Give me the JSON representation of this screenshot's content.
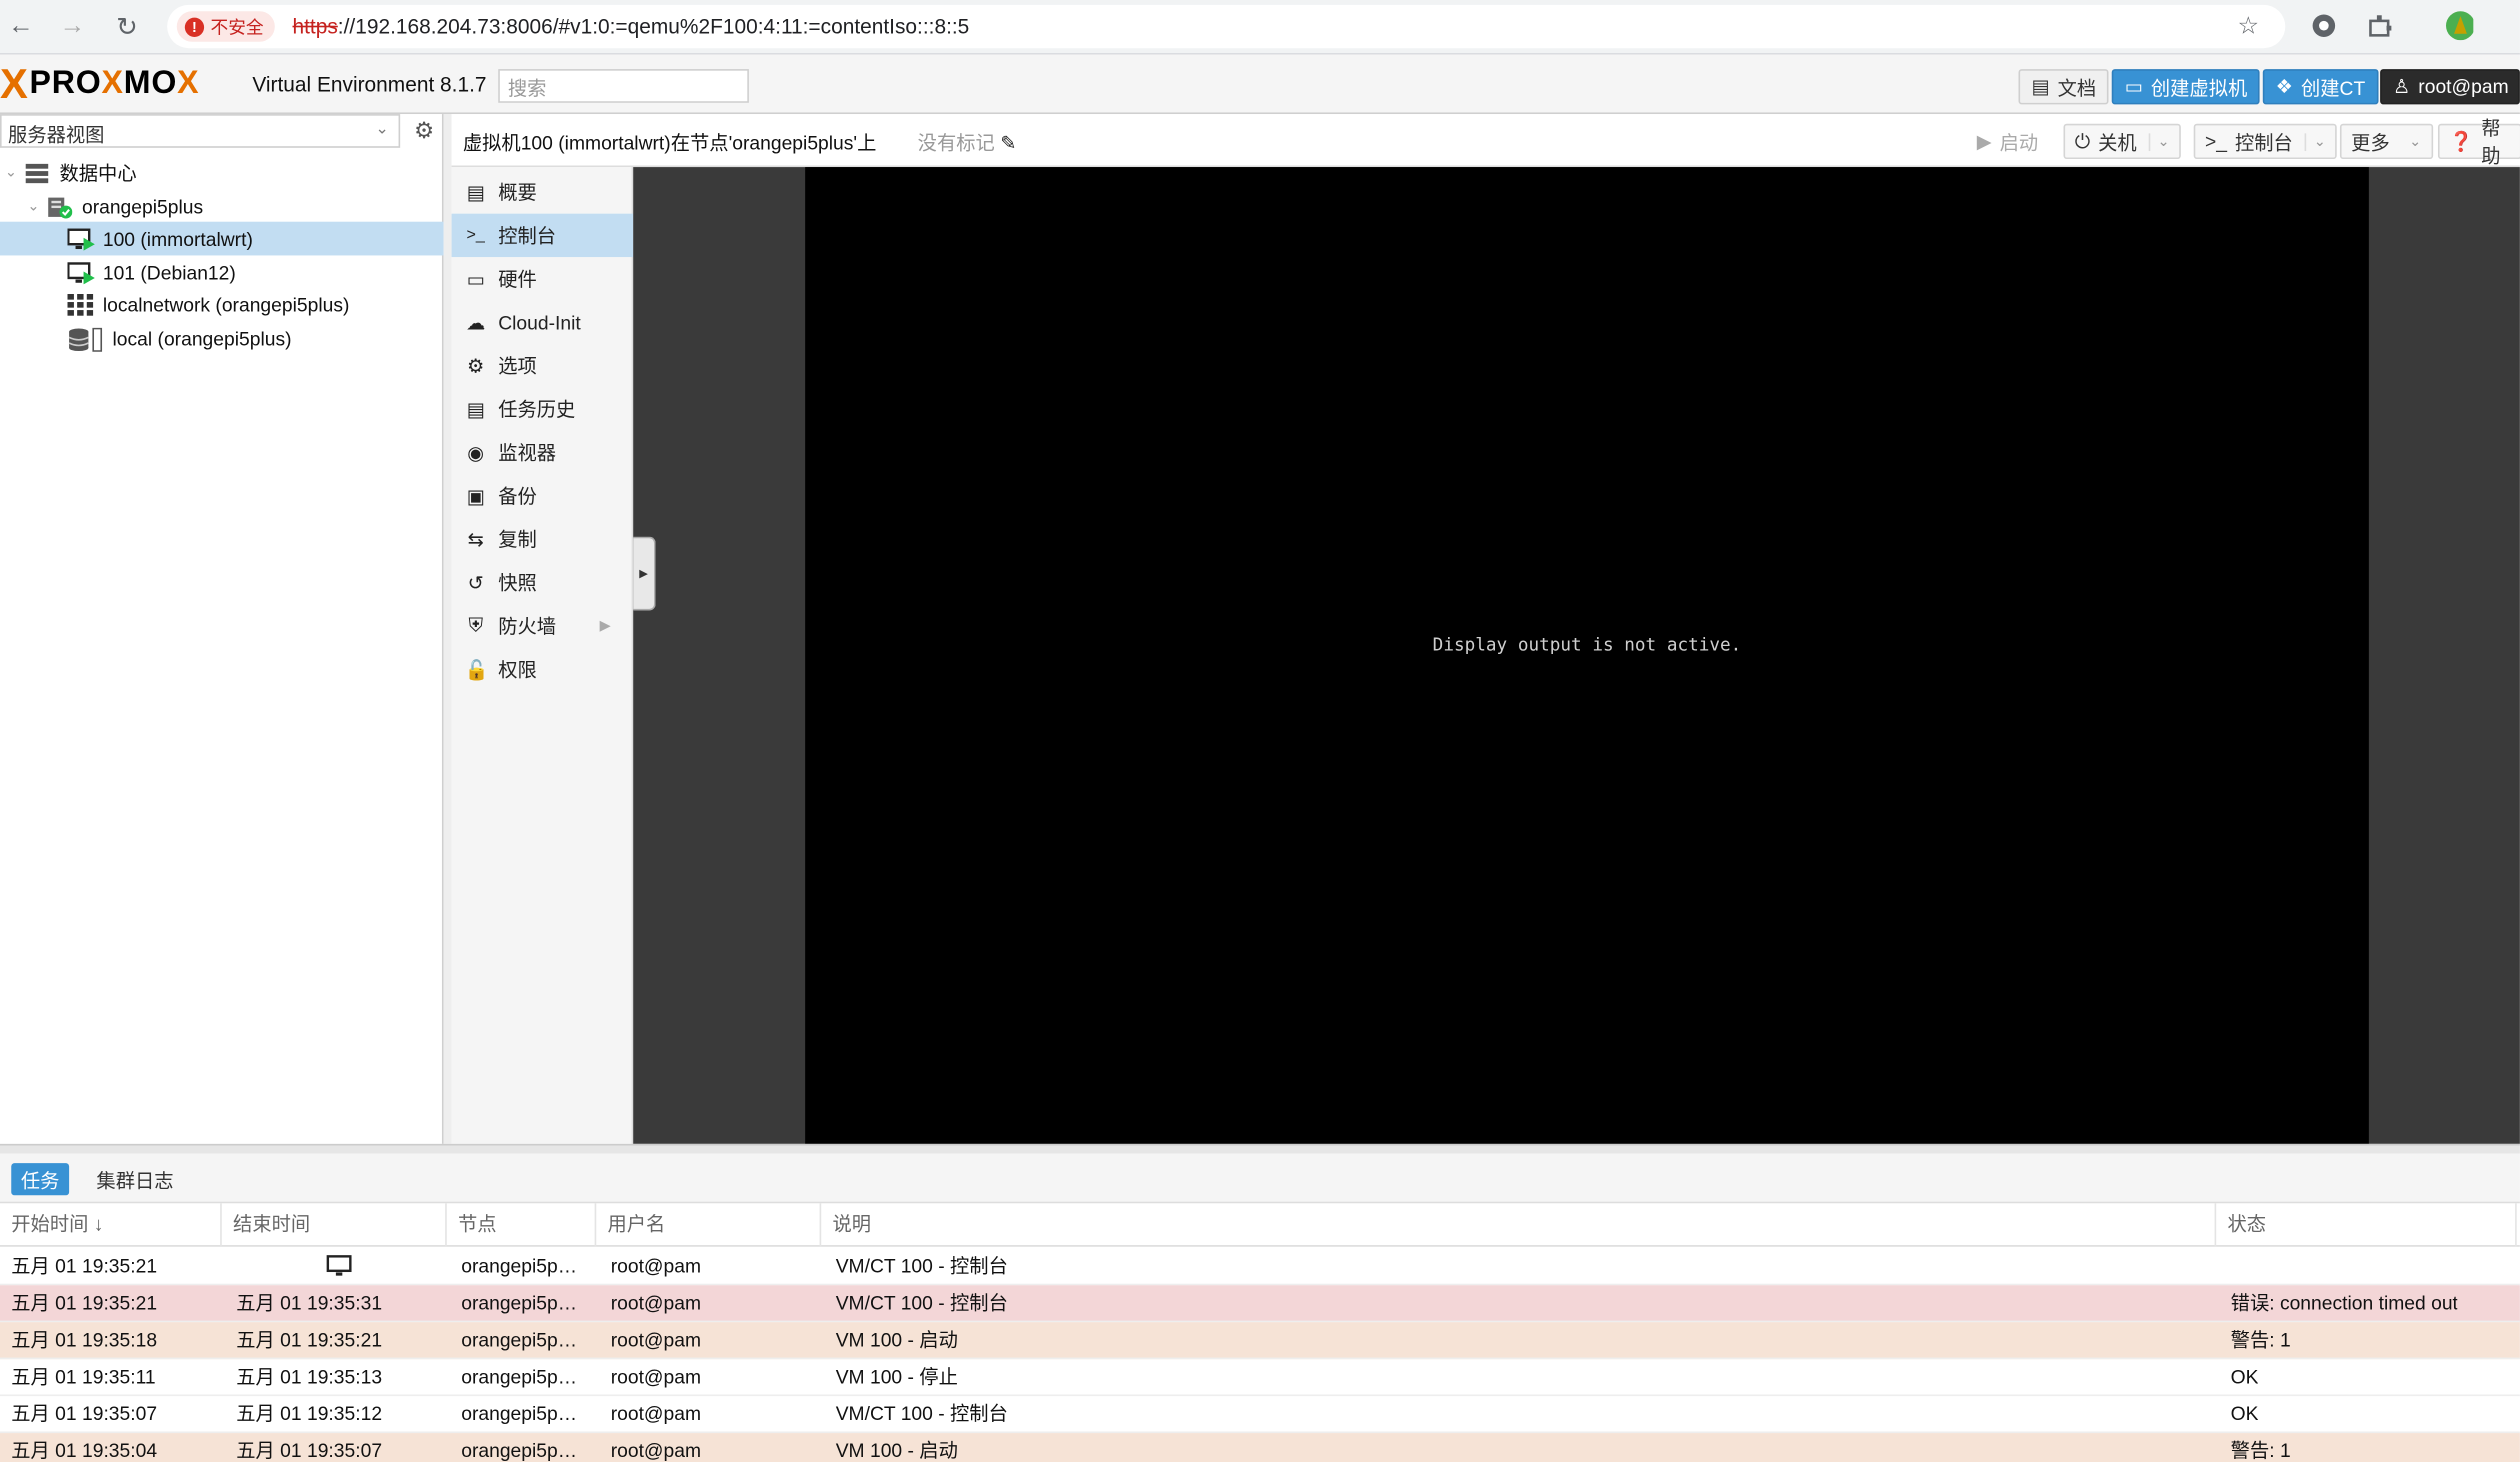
{
  "browser": {
    "insecure_label": "不安全",
    "url_scheme": "https",
    "url_rest": "://192.168.204.73:8006/#v1:0:=qemu%2F100:4:11:=contentIso:::8::5"
  },
  "header": {
    "logo_text_pre": "PRO",
    "logo_text_x": "X",
    "logo_text_post": "MO",
    "logo_text_end": "X",
    "version": "Virtual Environment 8.1.7",
    "search_placeholder": "搜索",
    "docs_label": "文档",
    "create_vm_label": "创建虚拟机",
    "create_ct_label": "创建CT",
    "user_label": "root@pam"
  },
  "tree": {
    "view_label": "服务器视图",
    "items": [
      {
        "label": "数据中心"
      },
      {
        "label": "orangepi5plus"
      },
      {
        "label": "100 (immortalwrt)"
      },
      {
        "label": "101 (Debian12)"
      },
      {
        "label": "localnetwork (orangepi5plus)"
      },
      {
        "label": "local (orangepi5plus)"
      }
    ]
  },
  "content": {
    "title": "虚拟机100 (immortalwrt)在节点'orangepi5plus'上",
    "tags_label": "没有标记",
    "start_label": "启动",
    "shutdown_label": "关机",
    "console_label": "控制台",
    "more_label": "更多",
    "help_label": "帮助"
  },
  "menu": {
    "items": [
      {
        "label": "概要",
        "icon": "book-icon"
      },
      {
        "label": "控制台",
        "icon": "terminal-icon"
      },
      {
        "label": "硬件",
        "icon": "monitor-icon"
      },
      {
        "label": "Cloud-Init",
        "icon": "cloud-icon"
      },
      {
        "label": "选项",
        "icon": "gear-icon"
      },
      {
        "label": "任务历史",
        "icon": "list-icon"
      },
      {
        "label": "监视器",
        "icon": "eye-icon"
      },
      {
        "label": "备份",
        "icon": "floppy-icon"
      },
      {
        "label": "复制",
        "icon": "retweet-icon"
      },
      {
        "label": "快照",
        "icon": "history-icon"
      },
      {
        "label": "防火墙",
        "icon": "shield-icon"
      },
      {
        "label": "权限",
        "icon": "unlock-icon"
      }
    ]
  },
  "console": {
    "message": "Display output is not active."
  },
  "tasks": {
    "tab_tasks": "任务",
    "tab_cluster_log": "集群日志",
    "columns": {
      "start": "开始时间",
      "end": "结束时间",
      "node": "节点",
      "user": "用户名",
      "desc": "说明",
      "status": "状态"
    },
    "rows": [
      {
        "start": "五月 01 19:35:21",
        "end": "",
        "node": "orangepi5p…",
        "user": "root@pam",
        "desc": "VM/CT 100 - 控制台",
        "status": "",
        "type": "normal"
      },
      {
        "start": "五月 01 19:35:21",
        "end": "五月 01 19:35:31",
        "node": "orangepi5p…",
        "user": "root@pam",
        "desc": "VM/CT 100 - 控制台",
        "status": "错误: connection timed out",
        "type": "err"
      },
      {
        "start": "五月 01 19:35:18",
        "end": "五月 01 19:35:21",
        "node": "orangepi5p…",
        "user": "root@pam",
        "desc": "VM 100 - 启动",
        "status": "警告: 1",
        "type": "warn"
      },
      {
        "start": "五月 01 19:35:11",
        "end": "五月 01 19:35:13",
        "node": "orangepi5p…",
        "user": "root@pam",
        "desc": "VM 100 - 停止",
        "status": "OK",
        "type": "normal"
      },
      {
        "start": "五月 01 19:35:07",
        "end": "五月 01 19:35:12",
        "node": "orangepi5p…",
        "user": "root@pam",
        "desc": "VM/CT 100 - 控制台",
        "status": "OK",
        "type": "normal"
      },
      {
        "start": "五月 01 19:35:04",
        "end": "五月 01 19:35:07",
        "node": "orangepi5p…",
        "user": "root@pam",
        "desc": "VM 100 - 启动",
        "status": "警告: 1",
        "type": "warn"
      }
    ]
  },
  "colors": {
    "brand_orange": "#e57000",
    "accent_blue": "#3892d4",
    "selection": "#c2ddf2"
  }
}
